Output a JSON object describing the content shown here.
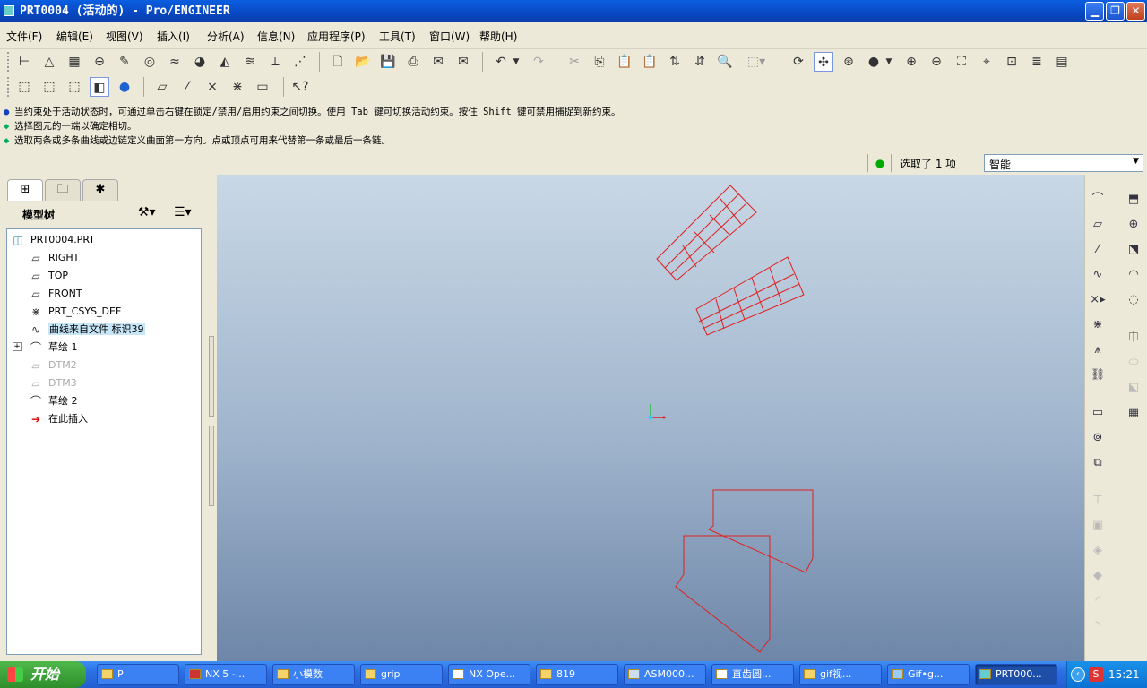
{
  "window": {
    "title": "PRT0004 (活动的) - Pro/ENGINEER",
    "min_symbol": "▁",
    "max_symbol": "❐",
    "close_symbol": "✕"
  },
  "menu": [
    "文件(F)",
    "编辑(E)",
    "视图(V)",
    "插入(I)",
    "分析(A)",
    "信息(N)",
    "应用程序(P)",
    "工具(T)",
    "窗口(W)",
    "帮助(H)"
  ],
  "messages": [
    {
      "marker": "●",
      "text": "当约束处于活动状态时，可通过单击右键在锁定/禁用/启用约束之间切换。使用 Tab 键可切换活动约束。按住 Shift 键可禁用捕捉到新约束。"
    },
    {
      "marker": "◆",
      "text": "选择图元的一端以确定相切。"
    },
    {
      "marker": "◆",
      "text": "选取两条或多条曲线或边链定义曲面第一方向。点或顶点可用来代替第一条或最后一条链。"
    }
  ],
  "status": {
    "selected": "选取了 1 项",
    "filter": "智能"
  },
  "tree": {
    "title": "模型树",
    "items": [
      {
        "label": "PRT0004.PRT",
        "icon": "part-icon",
        "dim": false
      },
      {
        "label": "RIGHT",
        "icon": "datum-plane-icon",
        "dim": false
      },
      {
        "label": "TOP",
        "icon": "datum-plane-icon",
        "dim": false
      },
      {
        "label": "FRONT",
        "icon": "datum-plane-icon",
        "dim": false
      },
      {
        "label": "PRT_CSYS_DEF",
        "icon": "csys-icon",
        "dim": false
      },
      {
        "label": "曲线来自文件 标识39",
        "icon": "curve-icon",
        "dim": false
      },
      {
        "label": "草绘 1",
        "icon": "sketch-icon",
        "dim": false
      },
      {
        "label": "DTM2",
        "icon": "datum-plane-icon",
        "dim": true
      },
      {
        "label": "DTM3",
        "icon": "datum-plane-icon",
        "dim": true
      },
      {
        "label": "草绘 2",
        "icon": "sketch-icon",
        "dim": false
      },
      {
        "label": "在此插入",
        "icon": "insert-here-arrow-icon",
        "dim": false
      }
    ]
  },
  "taskbar": {
    "start": "开始",
    "tasks": [
      "P",
      "NX 5 -...",
      "小模数",
      "grip",
      "NX Ope...",
      "819",
      "ASM000...",
      "直齿圆...",
      "gif视...",
      "Gif•g...",
      "PRT000..."
    ],
    "clock": "15:21"
  },
  "colors": {
    "curve": "#e02020",
    "viewport_top": "#c9d8e6",
    "viewport_bottom": "#6e86a8"
  }
}
